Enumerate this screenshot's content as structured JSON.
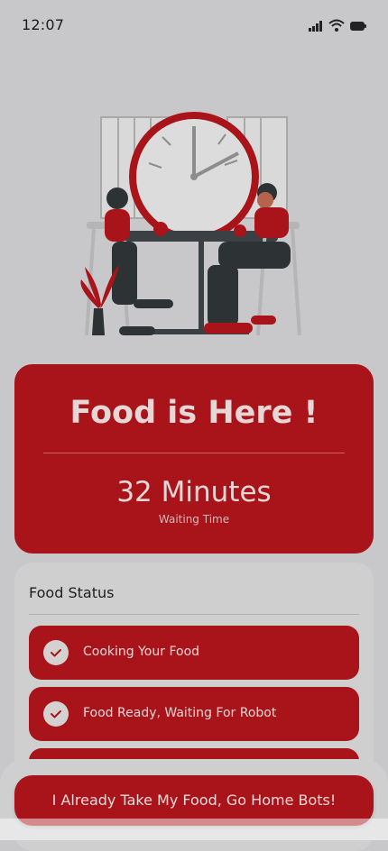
{
  "status_bar": {
    "time": "12:07",
    "icons": [
      "signal-icon",
      "wifi-icon",
      "battery-icon"
    ]
  },
  "illustration": {
    "icon": "waiting-for-food-illustration"
  },
  "hero": {
    "title": "Food is Here !",
    "value": "32 Minutes",
    "subtitle": "Waiting Time"
  },
  "panel": {
    "title": "Food Status",
    "steps": [
      {
        "label": "Cooking Your Food",
        "icon": "check-icon"
      },
      {
        "label": "Food Ready, Waiting For Robot",
        "icon": "check-icon"
      },
      {
        "label": "",
        "icon": "check-icon"
      }
    ]
  },
  "cta": {
    "label": "I Already Take My Food, Go Home Bots!"
  },
  "colors": {
    "accent": "#a8141a",
    "background": "#c8c8ca",
    "panel": "#cfcfcf"
  }
}
